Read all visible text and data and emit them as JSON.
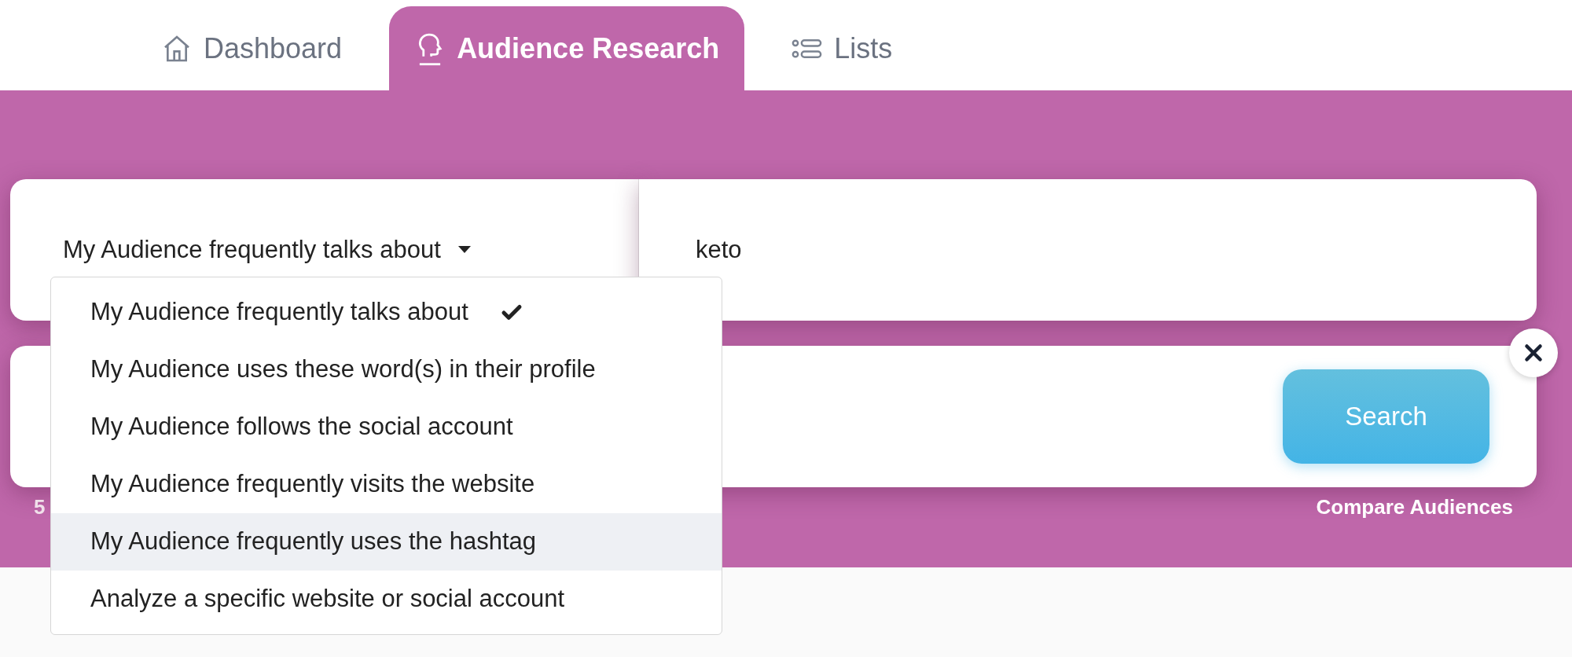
{
  "tabs": [
    {
      "label": "Dashboard",
      "selected": false
    },
    {
      "label": "Audience Research",
      "selected": true
    },
    {
      "label": "Lists",
      "selected": false
    }
  ],
  "criteria": {
    "dropdown": {
      "value": "My Audience frequently talks about",
      "expanded": true
    },
    "keyword": {
      "value": "keto"
    }
  },
  "dropdown_options": [
    {
      "label": "My Audience frequently talks about",
      "selected": true,
      "hovered": false
    },
    {
      "label": "My Audience uses these word(s) in their profile",
      "selected": false,
      "hovered": false
    },
    {
      "label": "My Audience follows the social account",
      "selected": false,
      "hovered": false
    },
    {
      "label": "My Audience frequently visits the website",
      "selected": false,
      "hovered": false
    },
    {
      "label": "My Audience frequently uses the hashtag",
      "selected": false,
      "hovered": true
    },
    {
      "label": "Analyze a specific website or social account",
      "selected": false,
      "hovered": false
    }
  ],
  "search_button": "Search",
  "count": "5",
  "compare_link": "Compare Audiences"
}
